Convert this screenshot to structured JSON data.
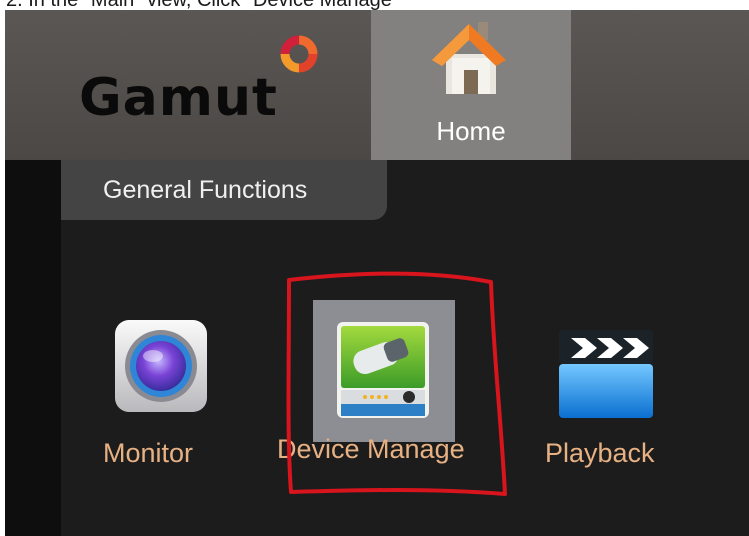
{
  "caption": "2. In the \"Main\" view, Click \"Device Manage\"",
  "header": {
    "logo_text": "Gamut",
    "home_tab_label": "Home"
  },
  "group_tab_label": "General Functions",
  "functions": [
    {
      "label": "Monitor"
    },
    {
      "label": "Device Manage"
    },
    {
      "label": "Playback"
    }
  ],
  "colors": {
    "accent_label": "#e8b183",
    "annotation": "#d8141c",
    "selected_tile": "#8d8d94"
  }
}
